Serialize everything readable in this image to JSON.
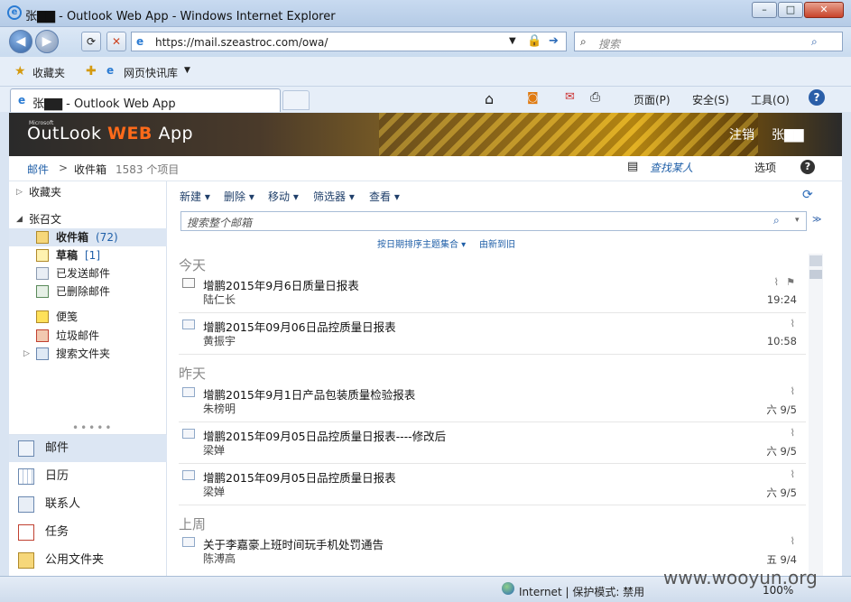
{
  "browser": {
    "title": "张▇▇ - Outlook Web App - Windows Internet Explorer",
    "address": "https://mail.szeastroc.com/owa/",
    "search_placeholder": "搜索",
    "favorites_label": "收藏夹",
    "quicklinks_label": "网页快讯库",
    "tab_title": "张▇▇ - Outlook Web App",
    "toolbar": {
      "page": "页面(P)",
      "safety": "安全(S)",
      "tools": "工具(O)"
    },
    "status_zone": "Internet | 保护模式: 禁用",
    "zoom": "100%"
  },
  "owa": {
    "logo_outlook": "OutLook",
    "logo_web": "WEB",
    "logo_app": "App",
    "logo_ms": "Microsoft",
    "signout": "注销",
    "user": "张▇▇"
  },
  "breadcrumb": {
    "mail": "邮件",
    "sep": ">",
    "inbox": "收件箱",
    "count": "1583 个项目"
  },
  "find_people": "查找某人",
  "options": "选项",
  "folders": {
    "favorites": "收藏夹",
    "account": "张召文",
    "items": [
      {
        "label": "收件箱",
        "count": "(72)"
      },
      {
        "label": "草稿",
        "count": "[1]"
      },
      {
        "label": "已发送邮件",
        "count": ""
      },
      {
        "label": "已删除邮件",
        "count": ""
      },
      {
        "label": "便笺",
        "count": ""
      },
      {
        "label": "垃圾邮件",
        "count": ""
      },
      {
        "label": "搜索文件夹",
        "count": ""
      }
    ]
  },
  "nav": [
    "邮件",
    "日历",
    "联系人",
    "任务",
    "公用文件夹"
  ],
  "mail_toolbar": {
    "new": "新建",
    "delete": "删除",
    "move": "移动",
    "filter": "筛选器",
    "view": "查看"
  },
  "mail_search_placeholder": "搜索整个邮箱",
  "sort": {
    "by": "按日期排序主题集合",
    "order": "由新到旧"
  },
  "groups": [
    {
      "label": "今天",
      "messages": [
        {
          "subject": "增鹏2015年9月6日质量日报表",
          "from": "陆仁长",
          "time": "19:24"
        },
        {
          "subject": "增鹏2015年09月06日品控质量日报表",
          "from": "黄振宇",
          "time": "10:58"
        }
      ]
    },
    {
      "label": "昨天",
      "messages": [
        {
          "subject": "增鹏2015年9月1日产品包装质量检验报表",
          "from": "朱榜明",
          "time": "六 9/5"
        },
        {
          "subject": "增鹏2015年09月05日品控质量日报表----修改后",
          "from": "梁婵",
          "time": "六 9/5"
        },
        {
          "subject": "增鹏2015年09月05日品控质量日报表",
          "from": "梁婵",
          "time": "六 9/5"
        }
      ]
    },
    {
      "label": "上周",
      "messages": [
        {
          "subject": "关于李嘉豪上班时间玩手机处罚通告",
          "from": "陈溥高",
          "time": "五 9/4"
        }
      ]
    }
  ],
  "watermark": "www.wooyun.org"
}
